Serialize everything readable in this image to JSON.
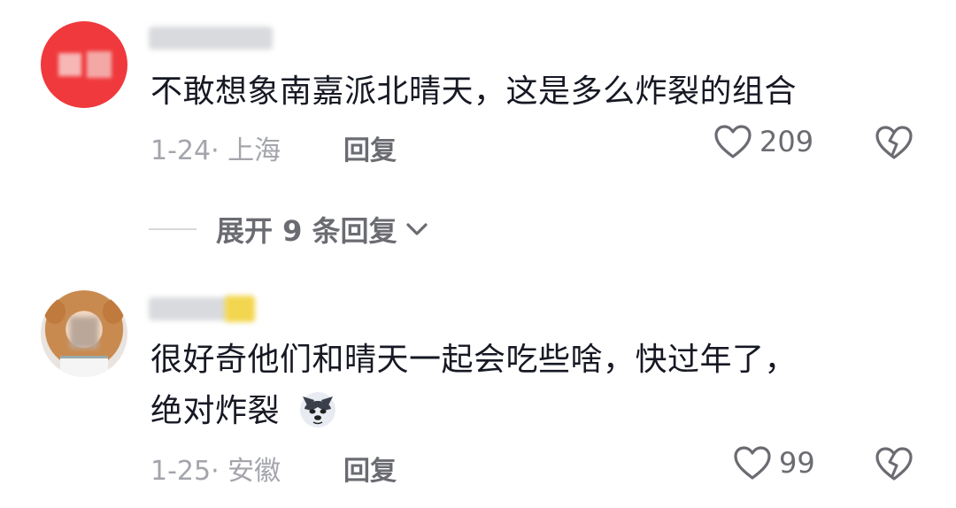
{
  "comments": [
    {
      "text": "不敢想象南嘉派北晴天，这是多么炸裂的组合",
      "date_location": "1-24· 上海",
      "reply_label": "回复",
      "like_count": "209"
    },
    {
      "text_line1": "很好奇他们和晴天一起会吃些啥，快过年了，",
      "text_line2": "绝对炸裂",
      "date_location": "1-25· 安徽",
      "reply_label": "回复",
      "like_count": "99"
    }
  ],
  "expand_replies": {
    "label": "展开 9 条回复"
  },
  "icons": {
    "like": "heart-outline-icon",
    "dislike": "broken-heart-icon",
    "expand": "chevron-down-icon",
    "emoji": "husky-dog-emoji"
  },
  "colors": {
    "text_primary": "#161823",
    "text_secondary": "#a3a5ab",
    "action": "#6b6c72",
    "avatar1_bg": "#f0393d"
  }
}
